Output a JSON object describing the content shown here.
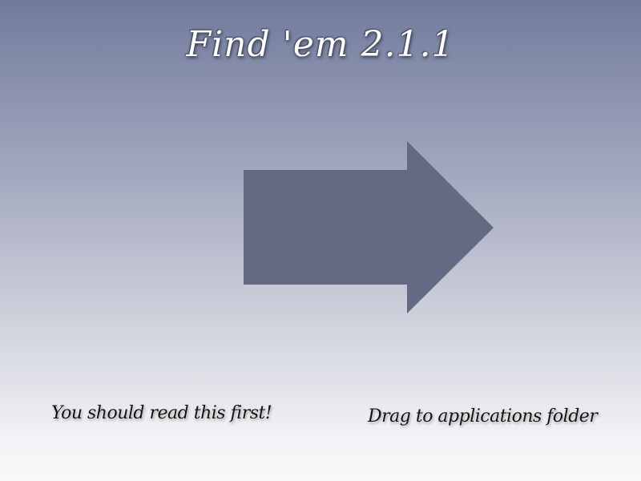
{
  "window": {
    "title": "Find 'em 2.1.1"
  },
  "installer": {
    "arrow_icon": "right-arrow-icon",
    "arrow_color": "#636a82",
    "readme_label": "You should read this first!",
    "drag_hint_label": "Drag to applications folder"
  }
}
